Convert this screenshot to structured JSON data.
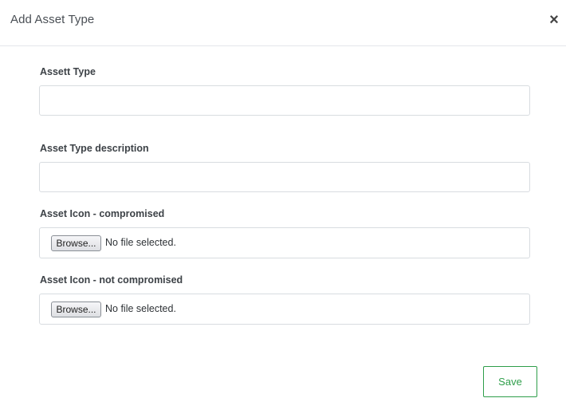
{
  "modal": {
    "title": "Add Asset Type",
    "close_label": "×"
  },
  "fields": {
    "asset_type": {
      "label": "Assett Type",
      "value": "",
      "placeholder": ""
    },
    "description": {
      "label": "Asset Type description",
      "value": "",
      "placeholder": ""
    },
    "icon_compromised": {
      "label": "Asset Icon - compromised",
      "browse_label": "Browse...",
      "status": "No file selected."
    },
    "icon_not_compromised": {
      "label": "Asset Icon - not compromised",
      "browse_label": "Browse...",
      "status": "No file selected."
    }
  },
  "footer": {
    "save_label": "Save"
  },
  "colors": {
    "save_accent": "#2e9e4a",
    "border": "#d8dce0"
  },
  "icons": {
    "close": "close-icon"
  }
}
